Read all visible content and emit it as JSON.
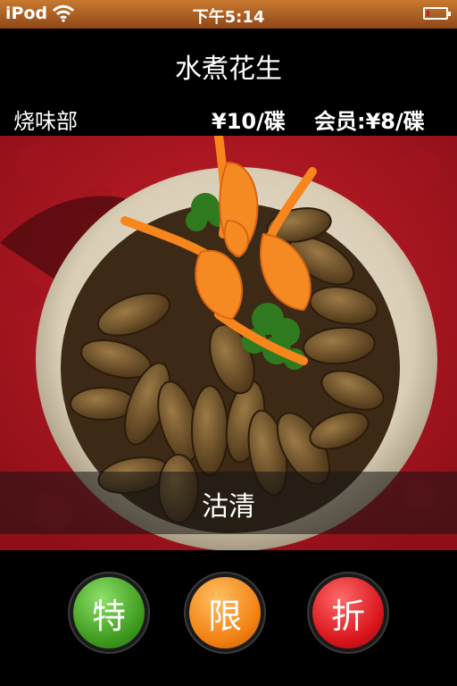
{
  "status_bar": {
    "carrier": "iPod",
    "time": "下午5:14"
  },
  "header": {
    "title": "水煮花生"
  },
  "info": {
    "category": "烧味部",
    "price": "¥10/碟",
    "member_price": "会员:¥8/碟"
  },
  "photo": {
    "caption": "沽清"
  },
  "actions": {
    "special_label": "特",
    "limited_label": "限",
    "discount_label": "折"
  },
  "colors": {
    "status_bar": "#b06327",
    "special": "#3d9a1d",
    "limited": "#f28012",
    "discount": "#d8141b",
    "tablecloth": "#b31a25"
  },
  "icons": {
    "wifi": "wifi-icon",
    "battery": "battery-icon"
  }
}
